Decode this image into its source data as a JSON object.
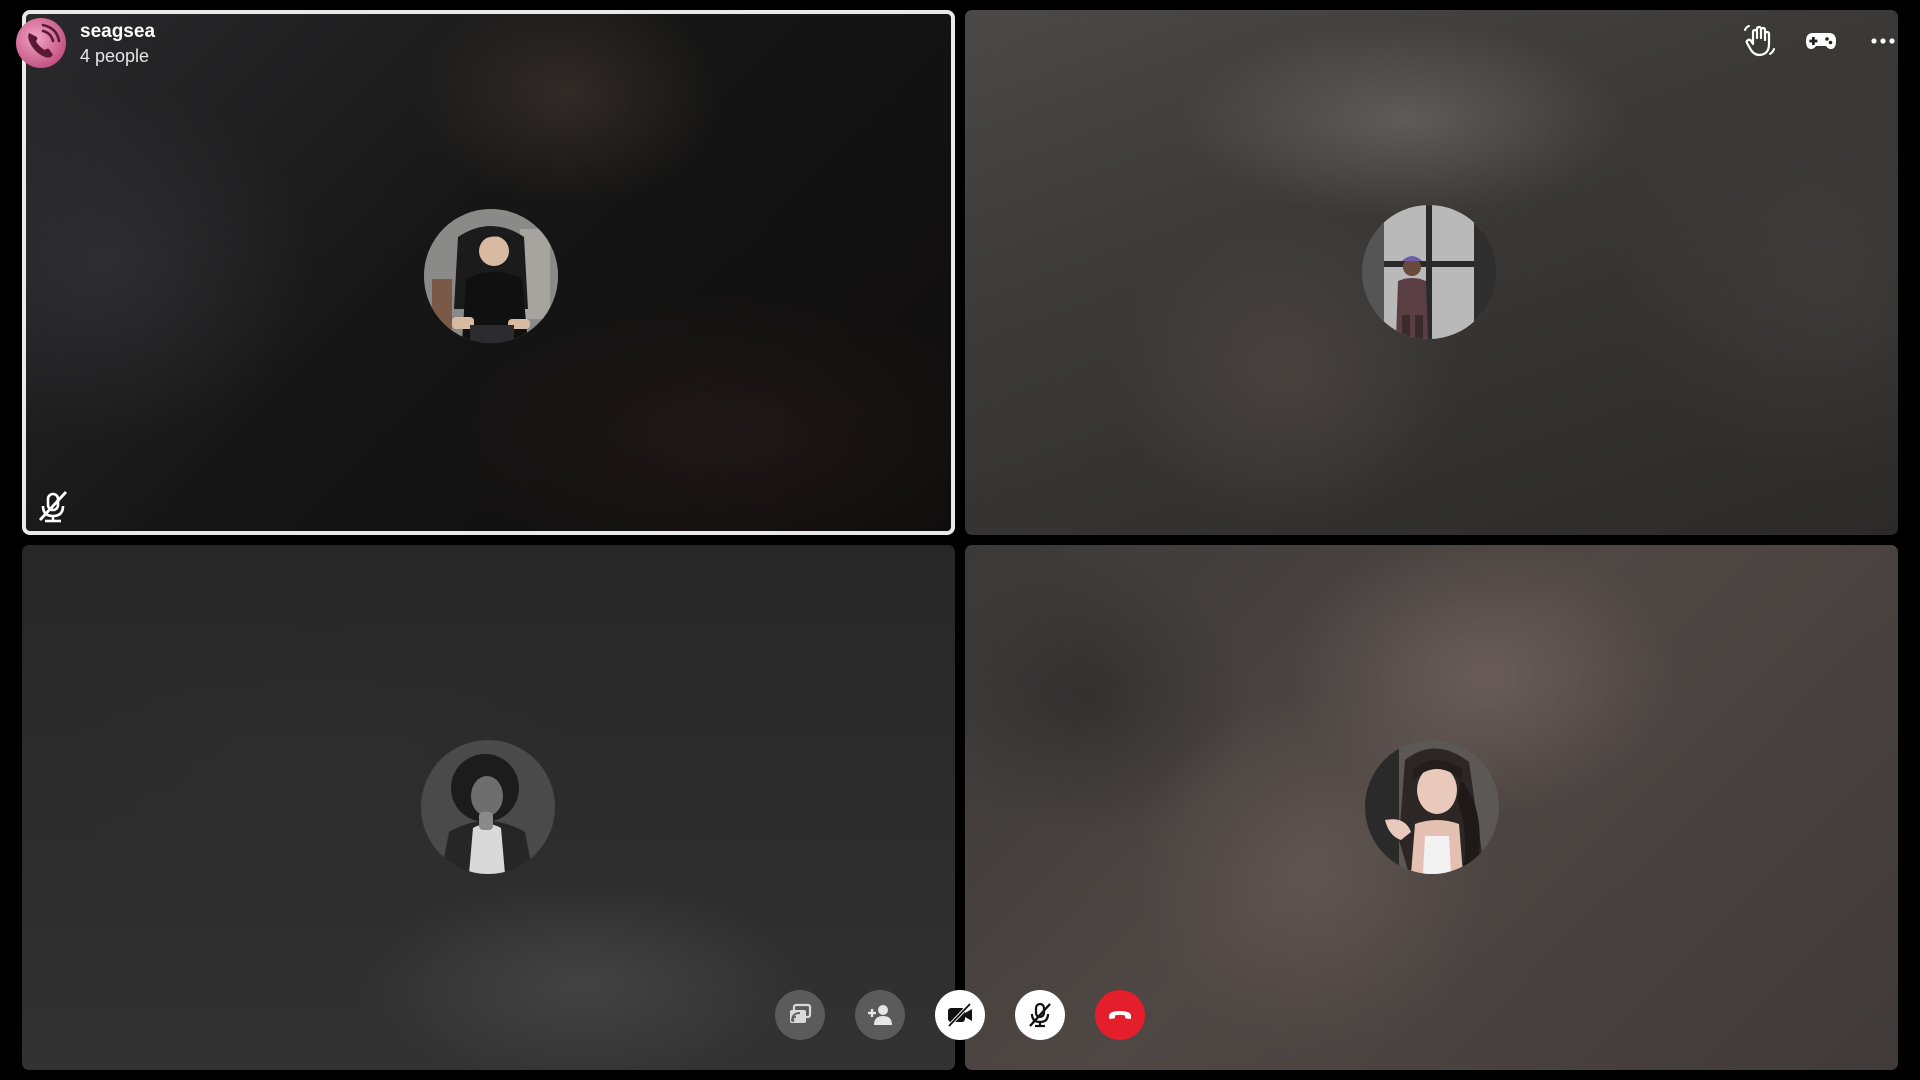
{
  "call": {
    "title": "seagsea",
    "participant_count_text": "4 people",
    "group_icon": "phone-waves-icon"
  },
  "top_actions": [
    {
      "name": "raise-hand",
      "icon": "hand-wave-icon"
    },
    {
      "name": "games",
      "icon": "gamepad-icon"
    },
    {
      "name": "more-options",
      "icon": "ellipsis-icon"
    }
  ],
  "participants": [
    {
      "avatar_icon": "person-in-gaming-chair",
      "muted": true,
      "active_speaker": true
    },
    {
      "avatar_icon": "person-standing-by-window",
      "muted": false,
      "active_speaker": false
    },
    {
      "avatar_icon": "person-monochrome-portrait",
      "muted": false,
      "active_speaker": false
    },
    {
      "avatar_icon": "person-long-hair-selfie",
      "muted": false,
      "active_speaker": false
    }
  ],
  "controls": [
    {
      "name": "share-screen",
      "icon": "screen-share-icon",
      "style": "grey"
    },
    {
      "name": "add-people",
      "icon": "add-person-icon",
      "style": "grey"
    },
    {
      "name": "camera-off",
      "icon": "video-off-icon",
      "style": "white"
    },
    {
      "name": "microphone-off",
      "icon": "mic-off-icon",
      "style": "white"
    },
    {
      "name": "end-call",
      "icon": "hang-up-icon",
      "style": "red"
    }
  ],
  "colors": {
    "active_border": "#e9e9ea",
    "end_call": "#e41e2b",
    "grey_button": "#5b5b5b",
    "background": "#000000"
  }
}
